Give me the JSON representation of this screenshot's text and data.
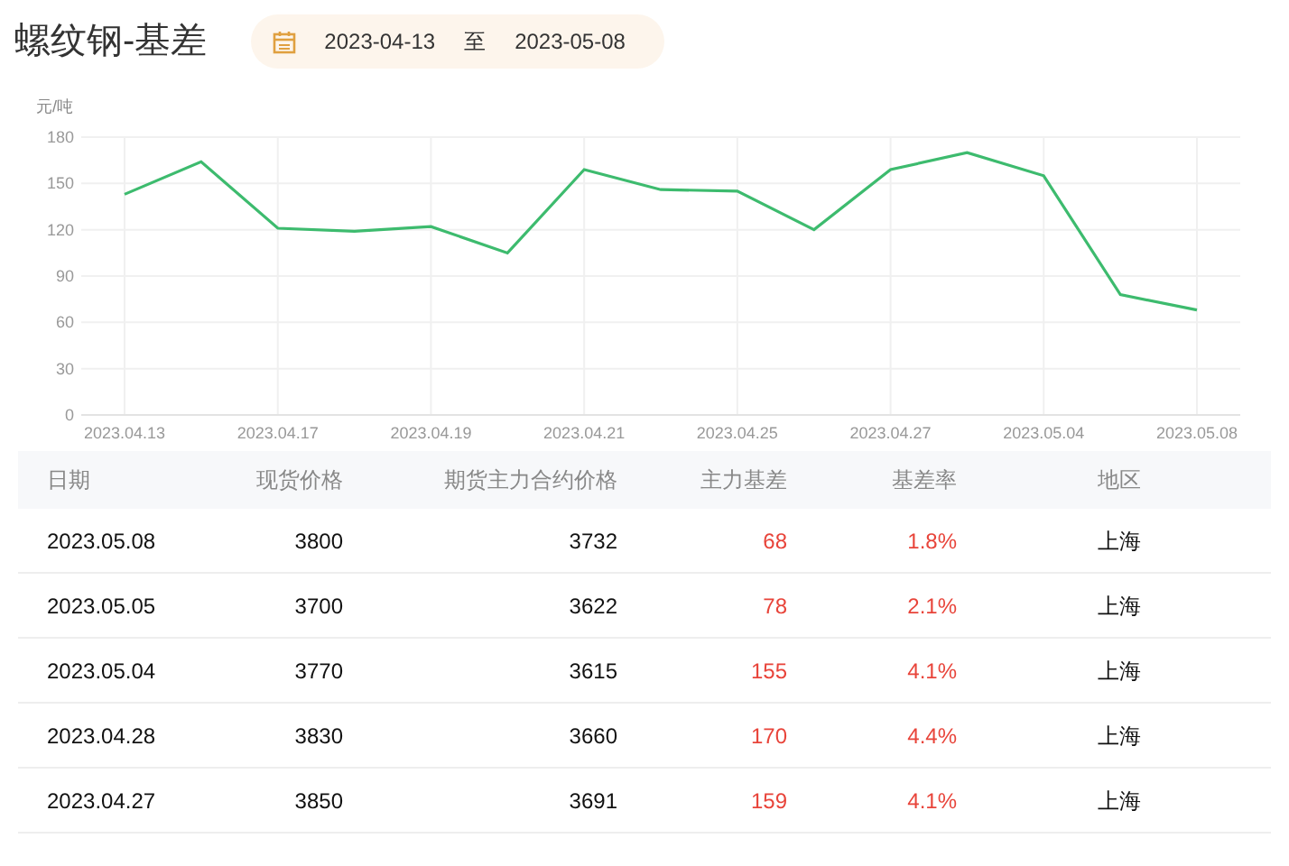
{
  "title": "螺纹钢-基差",
  "date_range": {
    "start": "2023-04-13",
    "separator": "至",
    "end": "2023-05-08"
  },
  "chart": {
    "chart_data": {
      "type": "line",
      "ylabel": "元/吨",
      "categories": [
        "2023.04.13",
        null,
        "2023.04.17",
        null,
        "2023.04.19",
        null,
        "2023.04.21",
        null,
        "2023.04.25",
        null,
        "2023.04.27",
        null,
        "2023.05.04",
        null,
        "2023.05.08"
      ],
      "series": [
        {
          "color": "#3dbb6e",
          "values": [
            143,
            164,
            121,
            119,
            122,
            105,
            159,
            146,
            145,
            120,
            159,
            170,
            155,
            78,
            68
          ]
        }
      ],
      "grid": true,
      "ylim": [
        0,
        180
      ],
      "yticks": [
        0,
        30,
        60,
        90,
        120,
        150,
        180
      ]
    }
  },
  "table": {
    "columns": [
      "日期",
      "现货价格",
      "期货主力合约价格",
      "主力基差",
      "基差率",
      "地区"
    ],
    "rows": [
      [
        "2023.05.08",
        "3800",
        "3732",
        "68",
        "1.8%",
        "上海"
      ],
      [
        "2023.05.05",
        "3700",
        "3622",
        "78",
        "2.1%",
        "上海"
      ],
      [
        "2023.05.04",
        "3770",
        "3615",
        "155",
        "4.1%",
        "上海"
      ],
      [
        "2023.04.28",
        "3830",
        "3660",
        "170",
        "4.4%",
        "上海"
      ],
      [
        "2023.04.27",
        "3850",
        "3691",
        "159",
        "4.1%",
        "上海"
      ]
    ]
  }
}
